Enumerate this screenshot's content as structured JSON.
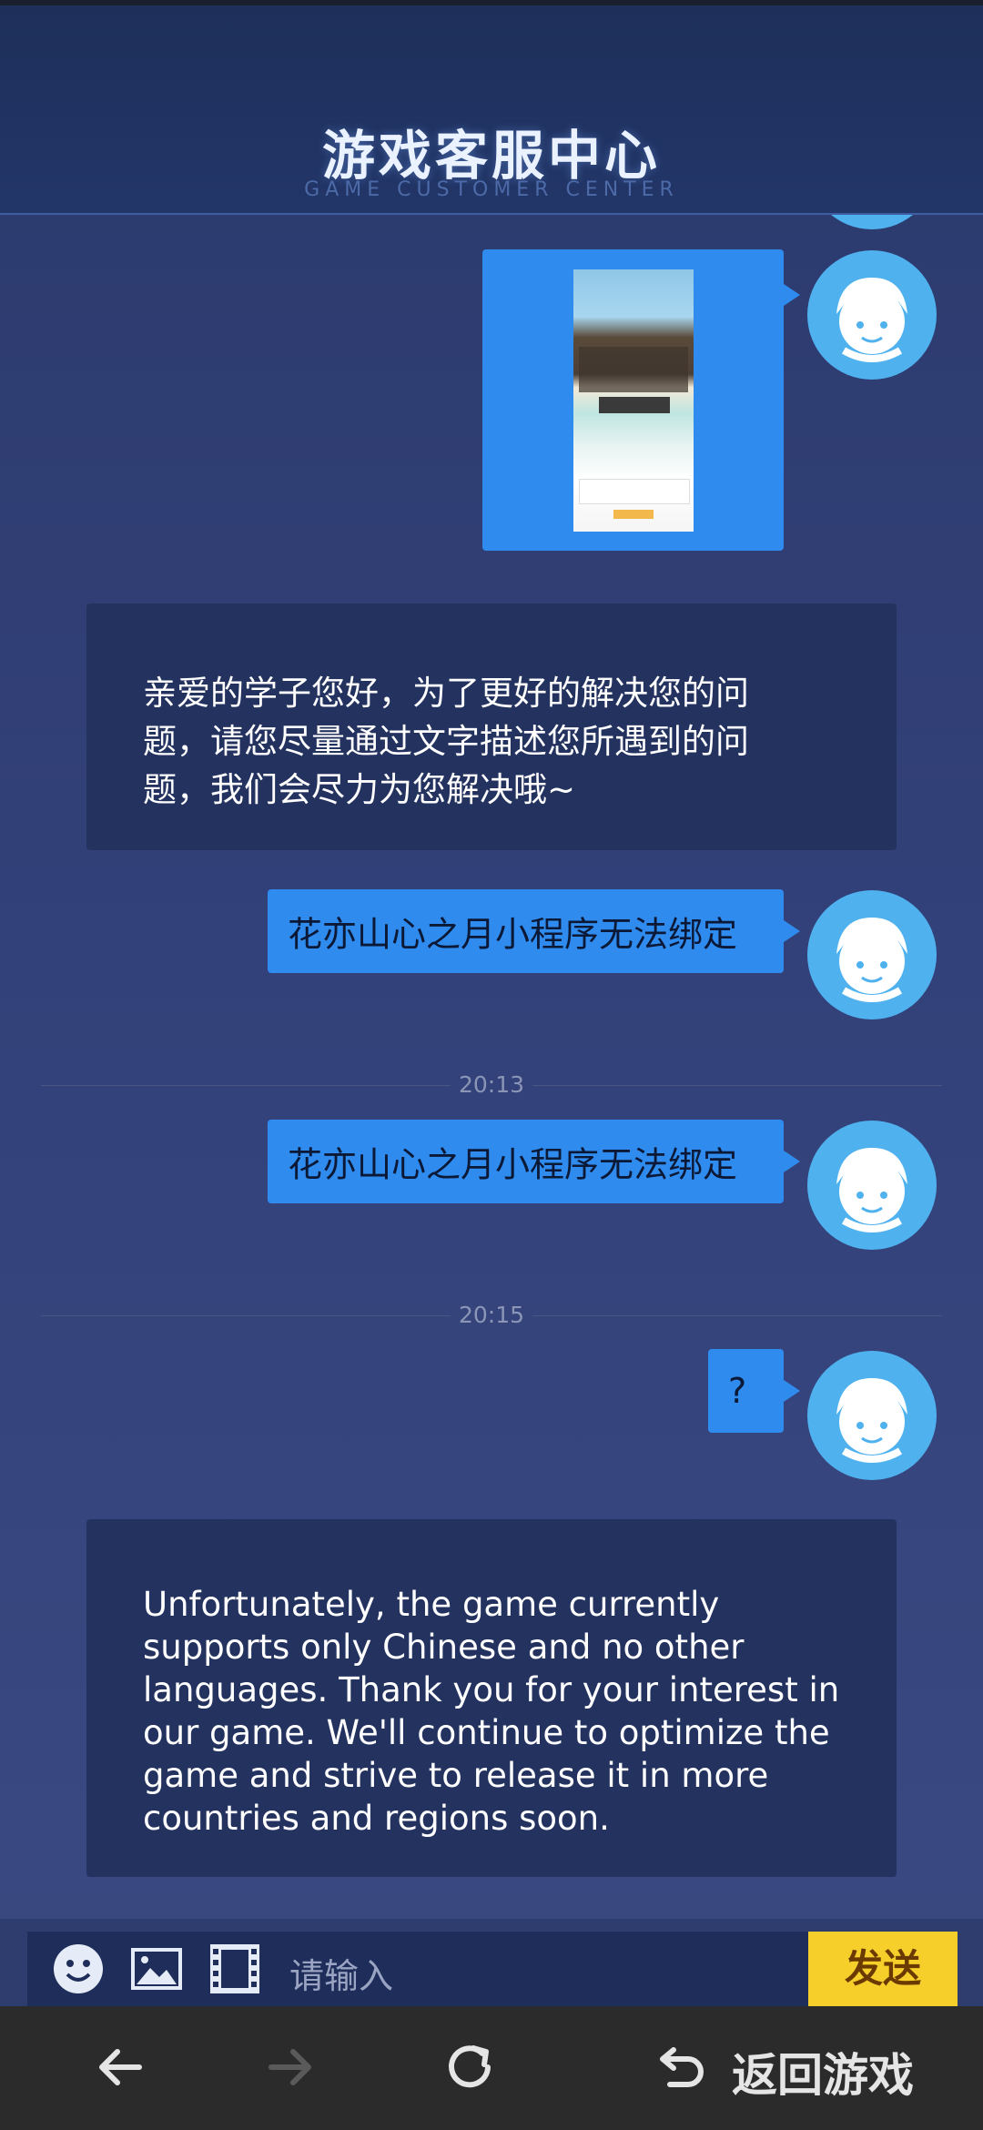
{
  "header": {
    "title": "游戏客服中心",
    "subtitle": "GAME CUSTOMER CENTER"
  },
  "messages": {
    "agent_1": {
      "lines": [
        "亲爱的学子您好，为了更好的解决您的问",
        "题，请您尽量通过文字描述您所遇到的问",
        "题，我们会尽力为您解决哦~"
      ]
    },
    "user_1": {
      "text": "花亦山心之月小程序无法绑定"
    },
    "time_1": "20:13",
    "user_2": {
      "text": "花亦山心之月小程序无法绑定"
    },
    "time_2": "20:15",
    "user_3": {
      "text": "?"
    },
    "agent_2": {
      "lines": [
        "Unfortunately, the game currently",
        "supports only Chinese and no other",
        "languages. Thank you for your interest in",
        "our game. We'll continue to optimize the",
        "game and strive to release it in more",
        "countries and regions soon."
      ]
    }
  },
  "input": {
    "placeholder": "请输入",
    "send_label": "发送",
    "tools": [
      "emoji-icon",
      "image-icon",
      "video-icon"
    ]
  },
  "nav": {
    "back_icon": "arrow-left-icon",
    "forward_icon": "arrow-right-icon",
    "refresh_icon": "refresh-icon",
    "return_icon": "return-icon",
    "return_label": "返回游戏"
  },
  "colors": {
    "user_bubble": "#2f8cee",
    "agent_bubble": "#23325f",
    "avatar": "#4fb2ef",
    "send_button": "#f6cf2a"
  }
}
